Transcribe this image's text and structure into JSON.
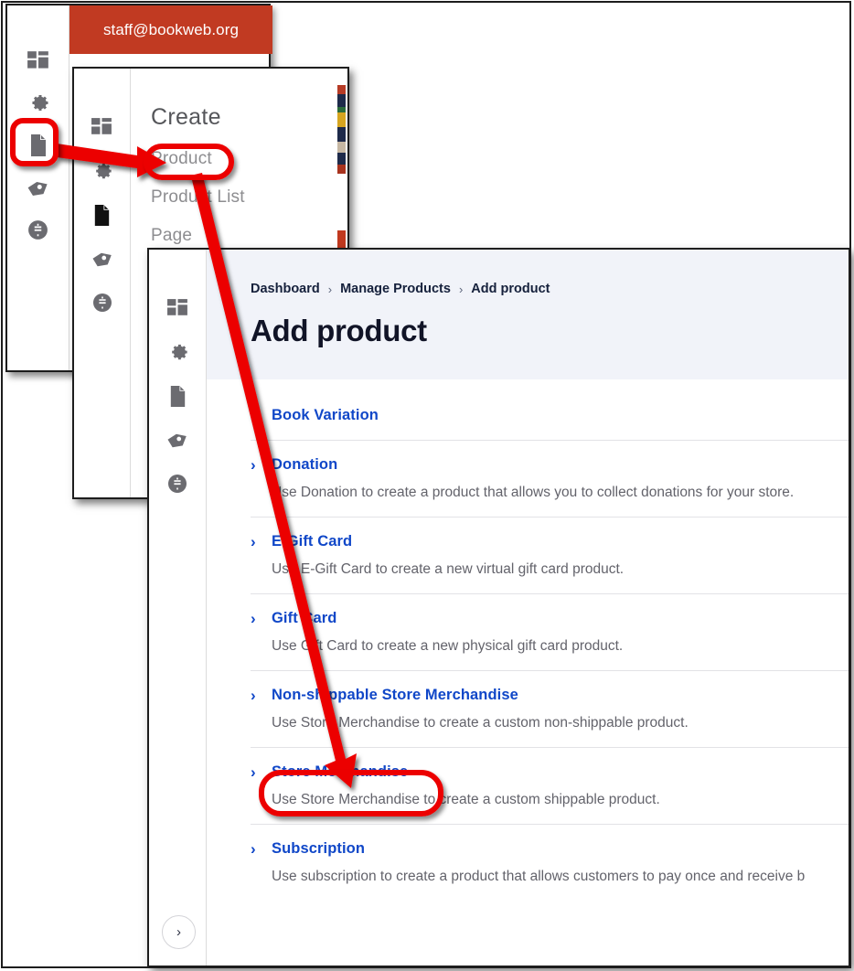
{
  "account_panel": {
    "email": "staff@bookweb.org",
    "rail_icons": [
      "dashboard-grid-icon",
      "gear-icon",
      "page-document-icon",
      "tag-icon",
      "dollar-circle-icon"
    ]
  },
  "create_panel": {
    "title": "Create",
    "items": [
      {
        "label": "Product"
      },
      {
        "label": "Product List"
      },
      {
        "label": "Page"
      }
    ],
    "rail_icons": [
      "dashboard-grid-icon",
      "gear-icon",
      "page-document-icon",
      "tag-icon",
      "dollar-circle-icon"
    ]
  },
  "add_product_panel": {
    "breadcrumb": [
      {
        "label": "Dashboard"
      },
      {
        "label": "Manage Products"
      },
      {
        "label": "Add product"
      }
    ],
    "breadcrumb_separator": "›",
    "page_title": "Add product",
    "expand_icon": "›",
    "rail_icons": [
      "dashboard-grid-icon",
      "gear-icon",
      "page-document-icon",
      "tag-icon",
      "dollar-circle-icon"
    ],
    "products": [
      {
        "name": "Book Variation",
        "description": "",
        "has_chevron": true,
        "highlighted": false
      },
      {
        "name": "Donation",
        "description": "Use Donation to create a product that allows you to collect donations for your store.",
        "has_chevron": true,
        "highlighted": false
      },
      {
        "name": "E-Gift Card",
        "description": "Use E-Gift Card to create a new virtual gift card product.",
        "has_chevron": true,
        "highlighted": false
      },
      {
        "name": "Gift Card",
        "description": "Use Gift Card to create a new physical gift card product.",
        "has_chevron": true,
        "highlighted": false
      },
      {
        "name": "Non-shippable Store Merchandise",
        "description": "Use Store Merchandise to create a custom non-shippable product.",
        "has_chevron": true,
        "highlighted": false
      },
      {
        "name": "Store Merchandise",
        "description": "Use Store Merchandise to create a custom shippable product.",
        "has_chevron": true,
        "highlighted": true
      },
      {
        "name": "Subscription",
        "description": "Use subscription to create a product that allows customers to pay once and receive b",
        "has_chevron": true,
        "highlighted": false
      }
    ]
  },
  "annotations": {
    "highlight_color": "#ec0000",
    "callouts": [
      {
        "target": "page-document-rail-icon",
        "shape": "rounded-square"
      },
      {
        "target": "create-menu-product-item",
        "shape": "pill"
      },
      {
        "target": "store-merchandise-row",
        "shape": "pill"
      }
    ],
    "arrows": [
      {
        "from": "page-document-rail-icon",
        "to": "create-menu-product-item"
      },
      {
        "from": "create-menu-product-item",
        "to": "store-merchandise-row"
      }
    ]
  },
  "colors": {
    "brand_red": "#c13a22",
    "link_blue": "#1047c8",
    "header_bg": "#f1f3f9",
    "annotation_red": "#ec0000"
  }
}
